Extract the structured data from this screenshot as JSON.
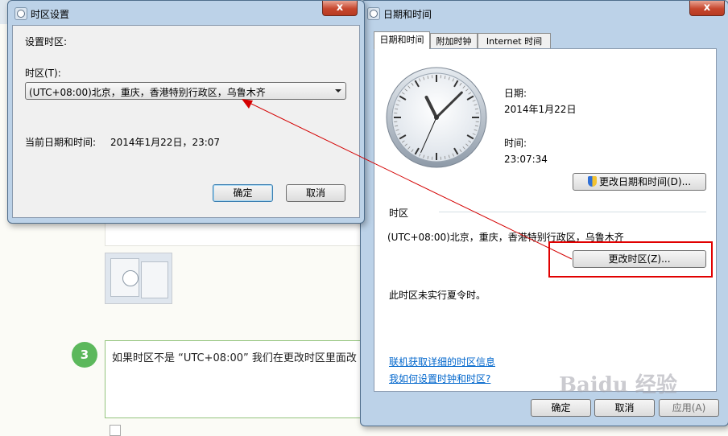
{
  "timezone_dialog": {
    "title": "时区设置",
    "set_timezone_label": "设置时区:",
    "timezone_field_label": "时区(T):",
    "timezone_selected": "(UTC+08:00)北京，重庆，香港特别行政区，乌鲁木齐",
    "current_datetime_label": "当前日期和时间:",
    "current_datetime_value": "2014年1月22日，23:07",
    "ok_label": "确定",
    "cancel_label": "取消",
    "close_glyph": "x"
  },
  "datetime_window": {
    "title": "日期和时间",
    "close_glyph": "x",
    "tabs": [
      {
        "label": "日期和时间"
      },
      {
        "label": "附加时钟"
      },
      {
        "label": "Internet 时间"
      }
    ],
    "date_label": "日期:",
    "date_value": "2014年1月22日",
    "time_label": "时间:",
    "time_value": "23:07:34",
    "change_datetime_label": "更改日期和时间(D)...",
    "timezone_group_label": "时区",
    "timezone_value": "(UTC+08:00)北京，重庆，香港特别行政区，乌鲁木齐",
    "change_timezone_label": "更改时区(Z)...",
    "dst_note": "此时区未实行夏令时。",
    "link_online_info": "联机获取详细的时区信息",
    "link_how_to_set": "我如何设置时钟和时区?",
    "ok_label": "确定",
    "cancel_label": "取消",
    "apply_label": "应用(A)"
  },
  "background": {
    "step_number": "3",
    "step_text": "如果时区不是 “UTC+08:00” 我们在更改时区里面改"
  },
  "watermark": "Baidu 经验",
  "clock": {
    "hours": 23,
    "minutes": 7,
    "seconds": 34
  },
  "colors": {
    "highlight": "#e10000",
    "arrow": "#d40000",
    "step_green": "#5cb85c",
    "link": "#0066cc"
  }
}
